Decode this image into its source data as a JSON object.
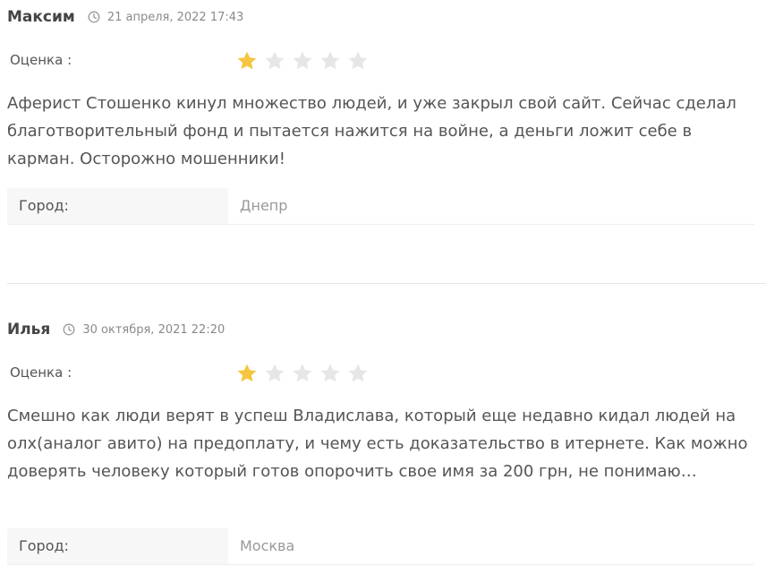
{
  "reviews": [
    {
      "author": "Максим",
      "date": "21 апреля, 2022 17:43",
      "rating_label": "Оценка :",
      "rating": 1,
      "max_rating": 5,
      "text": "Аферист Стошенко кинул множество людей, и уже закрыл свой сайт. Сейчас сделал благотворительный фонд и пытается нажится на войне, а деньги ложит себе в карман. Осторожно мошенники!",
      "field_label": "Город:",
      "field_value": "Днепр"
    },
    {
      "author": "Илья",
      "date": "30 октября, 2021 22:20",
      "rating_label": "Оценка :",
      "rating": 1,
      "max_rating": 5,
      "text": "Смешно как люди верят в успеш Владислава, который еще недавно кидал людей на олх(аналог авито) на предоплату, и чему есть доказательство в итернете. Как можно доверять человеку который готов опорочить свое имя за 200 грн, не понимаю…",
      "field_label": "Город:",
      "field_value": "Москва"
    }
  ],
  "colors": {
    "star_filled": "#f5c542",
    "star_empty": "#e6e6e6",
    "text": "#555555",
    "muted": "#999999"
  },
  "icons": {
    "date": "clock-icon",
    "rating": "star-icon"
  }
}
